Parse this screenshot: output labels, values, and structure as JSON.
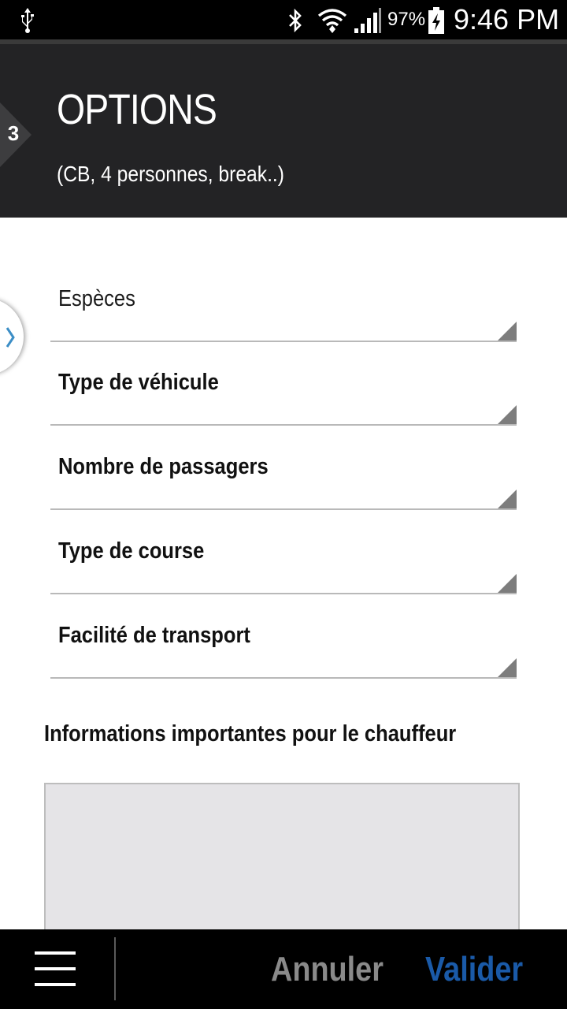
{
  "status_bar": {
    "battery_percent": "97%",
    "time": "9:46 PM",
    "icons": [
      "usb-icon",
      "bluetooth-icon",
      "wifi-icon",
      "signal-icon",
      "battery-charging-icon"
    ]
  },
  "header": {
    "step_number": "3",
    "title": "OPTIONS",
    "subtitle": "(CB, 4 personnes, break..)"
  },
  "fields": [
    {
      "label": "Espèces"
    },
    {
      "label": "Type de véhicule"
    },
    {
      "label": "Nombre de passagers"
    },
    {
      "label": "Type de course"
    },
    {
      "label": "Facilité de transport"
    }
  ],
  "driver_info": {
    "label": "Informations importantes pour le chauffeur",
    "value": ""
  },
  "bottom_bar": {
    "cancel_label": "Annuler",
    "validate_label": "Valider"
  },
  "colors": {
    "header_bg": "#232325",
    "accent_blue": "#1a5aa8",
    "cancel_gray": "#8a8a8a",
    "textarea_bg": "#e5e4e7"
  }
}
